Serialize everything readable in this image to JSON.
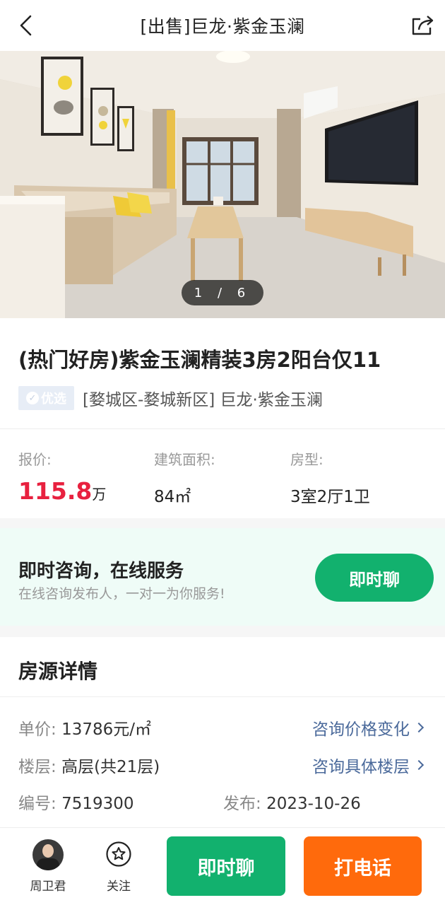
{
  "header": {
    "title": "[出售]巨龙·紫金玉澜"
  },
  "gallery": {
    "pager": "1 / 6"
  },
  "listing": {
    "title": "(热门好房)紫金玉澜精装3房2阳台仅11",
    "badge": "优选",
    "location": "[婺城区-婺城新区] 巨龙·紫金玉澜"
  },
  "stats": {
    "price_label": "报价:",
    "price_value": "115.8",
    "price_unit": "万",
    "area_label": "建筑面积:",
    "area_value": "84㎡",
    "layout_label": "房型:",
    "layout_value": "3室2厅1卫"
  },
  "consult": {
    "heading": "即时咨询，在线服务",
    "sub": "在线咨询发布人，一对一为你服务!",
    "button": "即时聊"
  },
  "details": {
    "section_title": "房源详情",
    "unit_price_key": "单价:",
    "unit_price_val": "13786元/㎡",
    "floor_key": "楼层:",
    "floor_val": "高层(共21层)",
    "code_key": "编号:",
    "code_val": "7519300",
    "publish_key": "发布:",
    "publish_val": "2023-10-26",
    "link_price": "咨询价格变化",
    "link_floor": "咨询具体楼层"
  },
  "bottom": {
    "agent_name": "周卫君",
    "follow_label": "关注",
    "chat_button": "即时聊",
    "call_button": "打电话"
  },
  "colors": {
    "green": "#12b16e",
    "orange": "#ff6a0c",
    "price_red": "#e8213f",
    "link_blue": "#4b6a9b"
  }
}
